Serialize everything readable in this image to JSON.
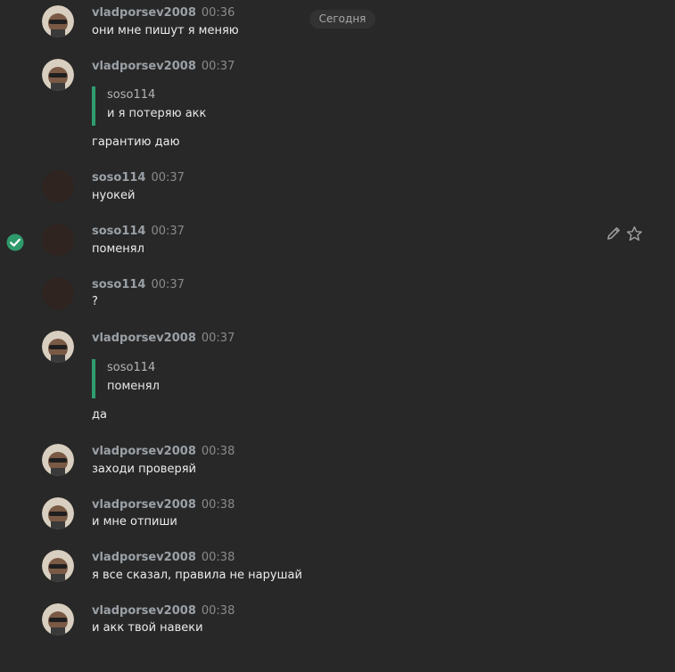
{
  "date_divider": "Сегодня",
  "messages": [
    {
      "author": "vladporsev2008",
      "time": "00:36",
      "text": "они мне пишут я меняю"
    },
    {
      "author": "vladporsev2008",
      "time": "00:37",
      "quote_author": "soso114",
      "quote_text": "и я потеряю акк",
      "text": "гарантию даю"
    },
    {
      "author": "soso114",
      "time": "00:37",
      "text": "нуокей"
    },
    {
      "author": "soso114",
      "time": "00:37",
      "text": "поменял"
    },
    {
      "author": "soso114",
      "time": "00:37",
      "text": "?"
    },
    {
      "author": "vladporsev2008",
      "time": "00:37",
      "quote_author": "soso114",
      "quote_text": "поменял",
      "text": "да"
    },
    {
      "author": "vladporsev2008",
      "time": "00:38",
      "text": "заходи проверяй"
    },
    {
      "author": "vladporsev2008",
      "time": "00:38",
      "text": "и мне отпиши"
    },
    {
      "author": "vladporsev2008",
      "time": "00:38",
      "text": "я все сказал, правила не нарушай"
    },
    {
      "author": "vladporsev2008",
      "time": "00:38",
      "text": "и акк твой навеки"
    }
  ],
  "icons": {
    "selected": "check-circle-icon",
    "edit": "pencil-icon",
    "favorite": "star-outline-icon"
  },
  "colors": {
    "background": "#282828",
    "quote_bar": "#2f9e6f",
    "check": "#2e9a6c"
  }
}
